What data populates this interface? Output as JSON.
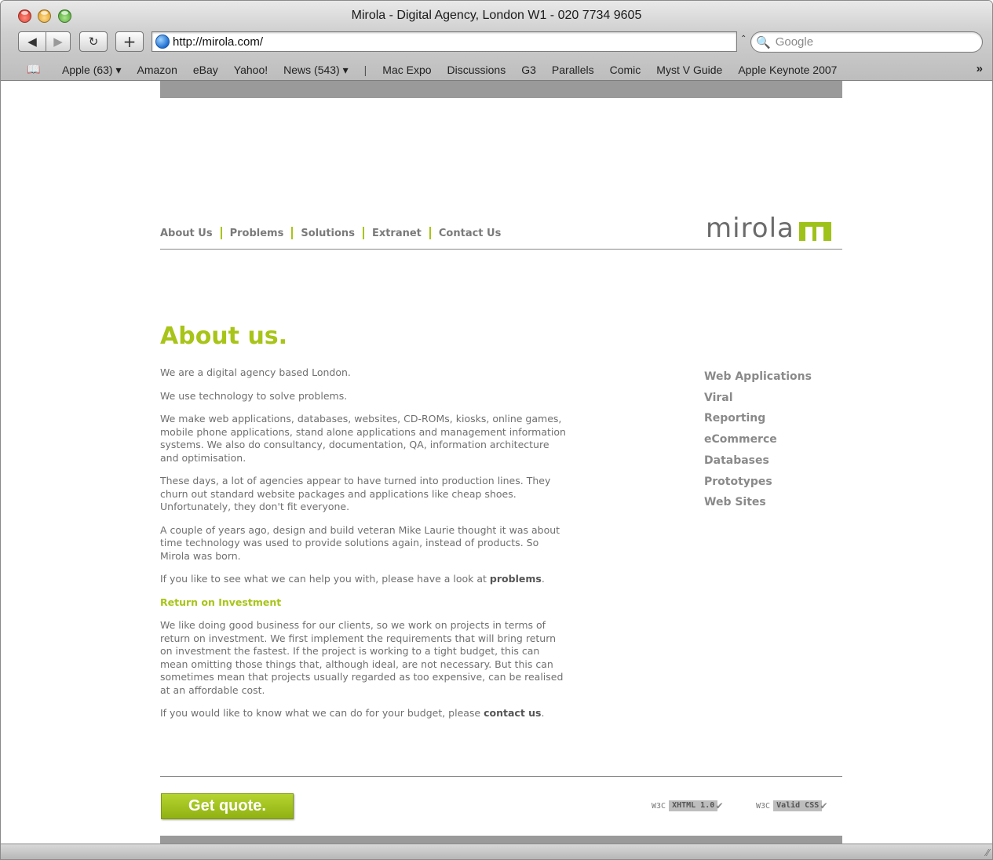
{
  "window": {
    "title": "Mirola - Digital Agency, London W1 - 020 7734 9605"
  },
  "toolbar": {
    "back_glyph": "◀",
    "forward_glyph": "▶",
    "reload_glyph": "↻",
    "add_glyph": "+",
    "address": "http://mirola.com/",
    "search_placeholder": "Google",
    "search_icon_glyph": "🔍",
    "caret_glyph": "⌃"
  },
  "bookmarks": {
    "book_glyph": "📖",
    "items": [
      "Apple (63) ▾",
      "Amazon",
      "eBay",
      "Yahoo!",
      "News (543) ▾",
      "|",
      "Mac Expo",
      "Discussions",
      "G3",
      "Parallels",
      "Comic",
      "Myst V Guide",
      "Apple Keynote 2007"
    ],
    "more_glyph": "»"
  },
  "site": {
    "nav": [
      "About Us",
      "Problems",
      "Solutions",
      "Extranet",
      "Contact Us"
    ],
    "logo_text": "mirola",
    "heading": "About us.",
    "paragraphs": [
      "We are a digital agency based London.",
      "We use technology to solve problems.",
      "We make web applications, databases, websites, CD-ROMs, kiosks, online games, mobile phone applications, stand alone applications and management information systems. We also do consultancy, documentation, QA, information architecture and optimisation.",
      "These days, a lot of agencies appear to have turned into production lines. They churn out standard website packages and applications like cheap shoes. Unfortunately, they don't fit everyone.",
      "A couple of years ago, design and build veteran Mike Laurie thought it was about time technology was used to provide solutions again, instead of products. So Mirola was born."
    ],
    "problems_pre": "If you like to see what we can help you with, please have a look at ",
    "problems_link": "problems",
    "problems_post": ".",
    "roi_title": "Return on Investment",
    "roi_text": "We like doing good business for our clients, so we work on projects in terms of return on investment. We first implement the requirements that will bring return on investment the fastest. If the project is working to a tight budget, this can mean omitting those things that, although ideal, are not necessary. But this can sometimes mean that projects usually regarded as too expensive, can be realised at an affordable cost.",
    "contact_pre": "If you would like to know what we can do for your budget, please ",
    "contact_link": "contact us",
    "contact_post": ".",
    "side_menu": [
      "Web Applications",
      "Viral",
      "Reporting",
      "eCommerce",
      "Databases",
      "Prototypes",
      "Web Sites"
    ],
    "quote_button": "Get quote.",
    "badges": {
      "xhtml_label": "W3C",
      "xhtml_box": "XHTML 1.0",
      "css_label": "W3C",
      "css_box": "Valid CSS",
      "check_glyph": "✔"
    }
  },
  "statusbar": {
    "grip_glyph": "⁄⁄"
  },
  "colors": {
    "accent": "#a8c418",
    "nav_text": "#7a7a7a",
    "body_text": "#6f6f6f"
  }
}
